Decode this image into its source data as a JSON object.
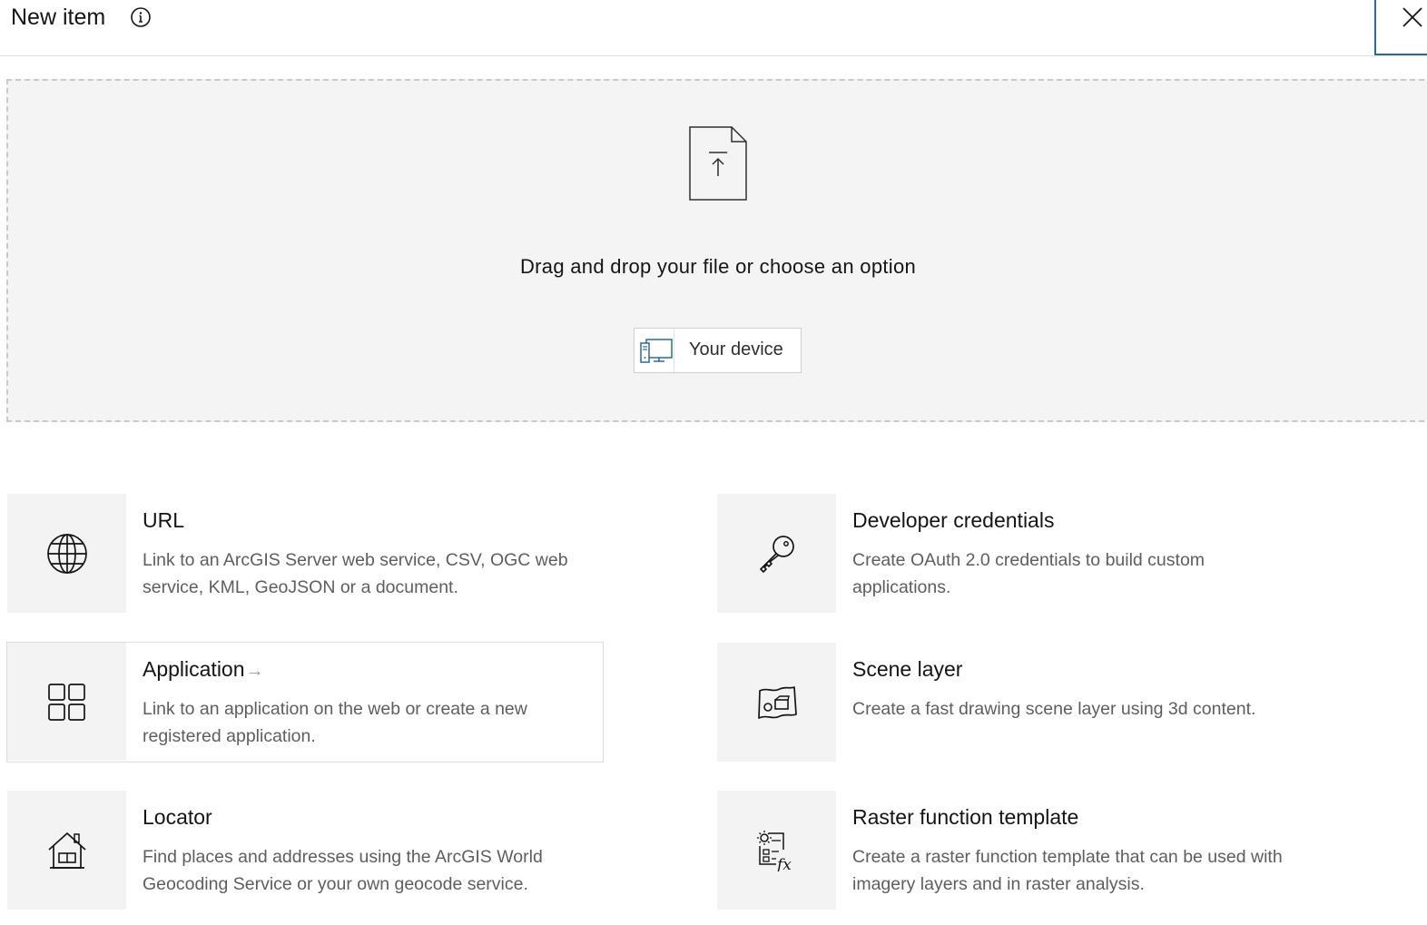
{
  "header": {
    "title": "New item"
  },
  "dropzone": {
    "instruction": "Drag and drop your file or choose an option",
    "device_button_label": "Your device"
  },
  "options": {
    "url": {
      "title": "URL",
      "description": "Link to an ArcGIS Server web service, CSV, OGC web service, KML, GeoJSON or a document."
    },
    "developer_credentials": {
      "title": "Developer credentials",
      "description": "Create OAuth 2.0 credentials to build custom applications."
    },
    "application": {
      "title": "Application",
      "description": "Link to an application on the web or create a new registered application."
    },
    "scene_layer": {
      "title": "Scene layer",
      "description": "Create a fast drawing scene layer using 3d content."
    },
    "locator": {
      "title": "Locator",
      "description": "Find places and addresses using the ArcGIS World Geocoding Service or your own geocode service."
    },
    "raster_function_template": {
      "title": "Raster function template",
      "description": "Create a raster function template that can be used with imagery layers and in raster analysis."
    }
  },
  "icons": {
    "info": "info-icon",
    "close": "close-icon",
    "upload_file": "file-upload-icon",
    "device": "device-icon",
    "url": "globe-icon",
    "developer_credentials": "key-icon",
    "application": "grid-icon",
    "scene_layer": "map-scene-icon",
    "locator": "house-icon",
    "raster_function_template": "raster-function-icon"
  },
  "colors": {
    "accent": "#2b6a99",
    "icon_panel": "#f3f3f3",
    "dropzone_bg": "#f4f4f4"
  }
}
